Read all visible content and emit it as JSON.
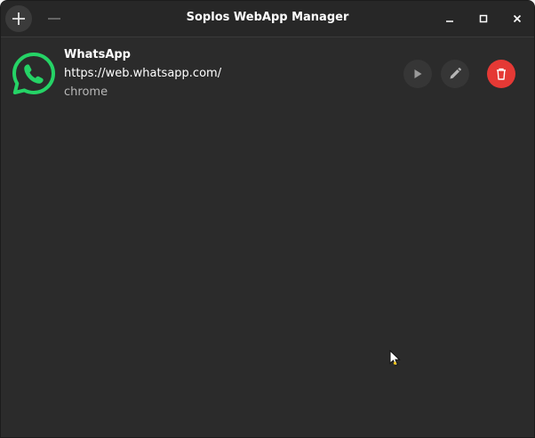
{
  "window": {
    "title": "Soplos WebApp Manager"
  },
  "webapps": [
    {
      "name": "WhatsApp",
      "url": "https://web.whatsapp.com/",
      "browser": "chrome",
      "icon": "whatsapp-icon"
    }
  ],
  "colors": {
    "background": "#2b2b2b",
    "titlebar": "#272727",
    "delete_accent": "#e53935",
    "whatsapp_green": "#25d366"
  }
}
